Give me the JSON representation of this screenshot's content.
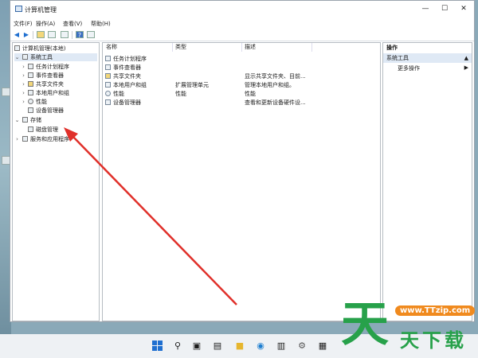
{
  "window": {
    "title": "计算机管理",
    "controls": {
      "minimize": "—",
      "maximize": "☐",
      "close": "✕"
    }
  },
  "menubar": [
    "文件(F)",
    "操作(A)",
    "查看(V)",
    "帮助(H)"
  ],
  "tree": {
    "root": "计算机管理(本地)",
    "system_tools": "系统工具",
    "children": [
      "任务计划程序",
      "事件查看器",
      "共享文件夹",
      "本地用户和组",
      "性能",
      "设备管理器"
    ],
    "storage": "存储",
    "disk_mgmt": "磁盘管理",
    "services": "服务和应用程序"
  },
  "list": {
    "headers": [
      "名称",
      "类型",
      "描述"
    ],
    "rows": [
      {
        "name": "任务计划程序",
        "type": "",
        "desc": ""
      },
      {
        "name": "事件查看器",
        "type": "",
        "desc": ""
      },
      {
        "name": "共享文件夹",
        "type": "",
        "desc": "显示共享文件夹、目前..."
      },
      {
        "name": "本地用户和组",
        "type": "扩展管理单元",
        "desc": "管理本地用户和组。"
      },
      {
        "name": "性能",
        "type": "性能",
        "desc": "性能"
      },
      {
        "name": "设备管理器",
        "type": "",
        "desc": "查看和更新设备硬件设..."
      }
    ]
  },
  "actions": {
    "header": "操作",
    "selected": "系统工具",
    "more": "更多操作"
  },
  "watermark": {
    "big": "天",
    "url": "www.TTzip.com",
    "small": "天下载"
  },
  "colors": {
    "accent": "#1f6fd0",
    "annotation": "#e0302a",
    "watermark_green": "#27a14a"
  }
}
